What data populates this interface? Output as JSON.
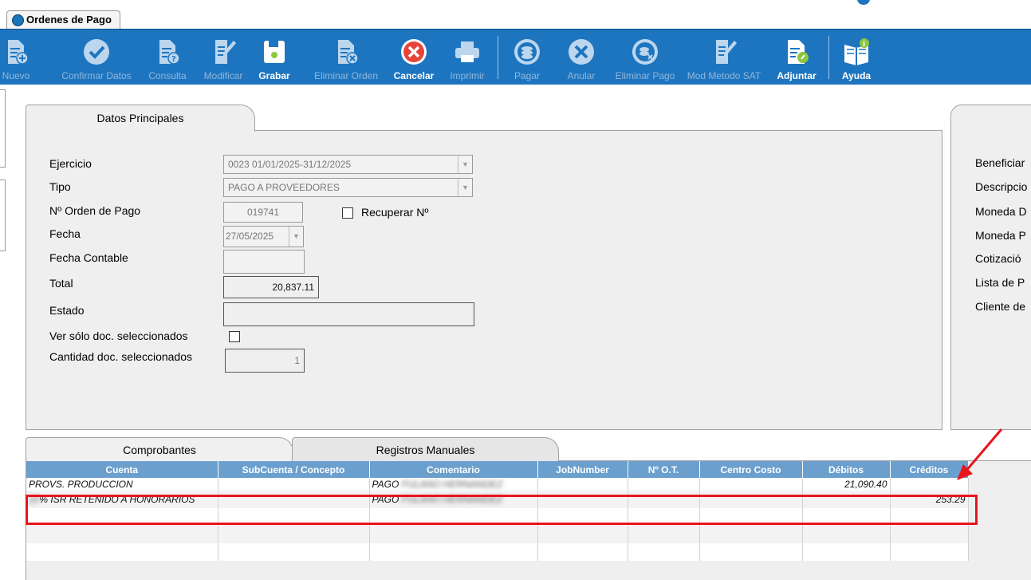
{
  "window": {
    "title": "Ordenes de Pago"
  },
  "toolbar": {
    "buttons": [
      {
        "label": "Nuevo",
        "icon": "doc-add-icon",
        "enabled": false
      },
      {
        "label": "Confirmar Datos",
        "icon": "check-icon",
        "enabled": false
      },
      {
        "label": "Consulta",
        "icon": "doc-question-icon",
        "enabled": false
      },
      {
        "label": "Modificar",
        "icon": "doc-edit-icon",
        "enabled": false
      },
      {
        "label": "Grabar",
        "icon": "save-icon",
        "enabled": true
      },
      {
        "label": "Eliminar Orden",
        "icon": "doc-delete-icon",
        "enabled": false
      },
      {
        "label": "Cancelar",
        "icon": "cancel-icon",
        "enabled": true
      },
      {
        "label": "Imprimir",
        "icon": "print-icon",
        "enabled": false
      },
      {
        "label": "Pagar",
        "icon": "coins-icon",
        "enabled": false
      },
      {
        "label": "Anular",
        "icon": "x-circle-icon",
        "enabled": false
      },
      {
        "label": "Eliminar Pago",
        "icon": "coins-delete-icon",
        "enabled": false
      },
      {
        "label": "Mod Metodo SAT",
        "icon": "doc-edit-icon",
        "enabled": false
      },
      {
        "label": "Adjuntar",
        "icon": "attach-icon",
        "enabled": true
      },
      {
        "label": "Ayuda",
        "icon": "help-book-icon",
        "enabled": true
      }
    ]
  },
  "main_tab": {
    "label": "Datos Principales"
  },
  "form": {
    "ejercicio": {
      "label": "Ejercicio",
      "value": "0023 01/01/2025-31/12/2025"
    },
    "tipo": {
      "label": "Tipo",
      "value": "PAGO A PROVEEDORES"
    },
    "orden": {
      "label": "Nº Orden de Pago",
      "value": "019741"
    },
    "recuperar": {
      "label": "Recuperar Nº"
    },
    "fecha": {
      "label": "Fecha",
      "value": "27/05/2025"
    },
    "fecha_contable": {
      "label": "Fecha Contable",
      "value": ""
    },
    "total": {
      "label": "Total",
      "value": "20,837.11"
    },
    "estado": {
      "label": "Estado",
      "value": ""
    },
    "ver_solo": {
      "label": "Ver sólo doc. seleccionados"
    },
    "cantidad": {
      "label": "Cantidad doc. seleccionados",
      "value": "1"
    }
  },
  "right_panel": {
    "labels": [
      "Beneficiar",
      "Descripcio",
      "Moneda D",
      "Moneda P",
      "Cotizació",
      "Lista de P",
      "Cliente de"
    ]
  },
  "lower_tabs": {
    "comprobantes": "Comprobantes",
    "registros": "Registros Manuales"
  },
  "grid": {
    "columns": [
      "Cuenta",
      "SubCuenta / Concepto",
      "Comentario",
      "JobNumber",
      "Nº O.T.",
      "Centro Costo",
      "Débitos",
      "Créditos"
    ],
    "rows": [
      {
        "cuenta": "PROVS. PRODUCCION",
        "subcuenta": "",
        "comentario": "PAGO",
        "comentario_hidden": "FULANO HERNANDEZ",
        "job": "",
        "ot": "",
        "centro": "",
        "debitos": "21,090.40",
        "creditos": ""
      },
      {
        "cuenta_hidden": "10",
        "cuenta": "% ISR RETENIDO A HONORARIOS",
        "subcuenta": "",
        "comentario": "PAGO",
        "comentario_hidden": "FULANO HERNANDEZ",
        "job": "",
        "ot": "",
        "centro": "",
        "debitos": "",
        "creditos": "253.29"
      }
    ]
  },
  "colors": {
    "toolbar": "#1e75bf",
    "header": "#6b9fcd",
    "highlight": "#e8141c"
  }
}
